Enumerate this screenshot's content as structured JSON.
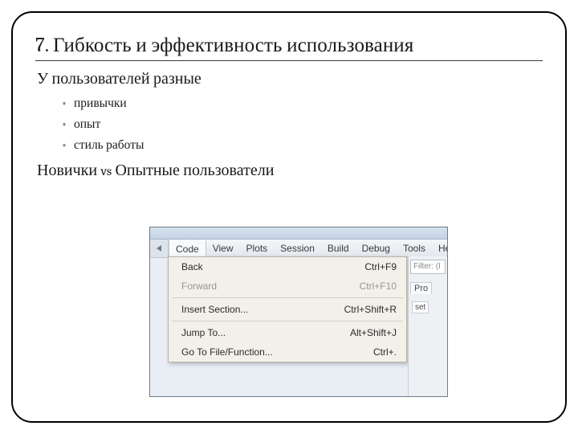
{
  "title": "7. Гибкость и эффективность использования",
  "subhead1": "У пользователей разные",
  "bullets": [
    "привычки",
    "опыт",
    "стиль работы"
  ],
  "subhead2_a": "Новички ",
  "subhead2_vs": "vs",
  "subhead2_b": " Опытные пользователи",
  "screenshot": {
    "tabs": [
      "Code",
      "View",
      "Plots",
      "Session",
      "Build",
      "Debug",
      "Tools",
      "He"
    ],
    "active_tab_index": 0,
    "menu": [
      {
        "label": "Back",
        "shortcut": "Ctrl+F9",
        "disabled": false,
        "sep_after": false
      },
      {
        "label": "Forward",
        "shortcut": "Ctrl+F10",
        "disabled": true,
        "sep_after": true
      },
      {
        "label": "Insert Section...",
        "shortcut": "Ctrl+Shift+R",
        "disabled": false,
        "sep_after": true
      },
      {
        "label": "Jump To...",
        "shortcut": "Alt+Shift+J",
        "disabled": false,
        "sep_after": false
      },
      {
        "label": "Go To File/Function...",
        "shortcut": "Ctrl+.",
        "disabled": false,
        "sep_after": false
      }
    ],
    "right_filter_placeholder": "Filter: (I",
    "right_tab": "Pro",
    "right_button": "set"
  }
}
